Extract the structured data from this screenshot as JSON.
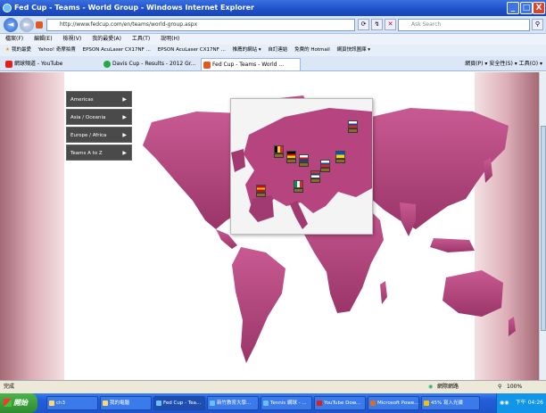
{
  "window": {
    "title": "Fed Cup - Teams - World Group - Windows Internet Explorer",
    "minimize": "_",
    "maximize": "□",
    "close": "X"
  },
  "address": {
    "back": "◄",
    "forward": "►",
    "url": "http://www.fedcup.com/en/teams/world-group.aspx",
    "search_placeholder": "Ask Search"
  },
  "menu": [
    "檔案(F)",
    "編輯(E)",
    "檢視(V)",
    "我的最愛(A)",
    "工具(T)",
    "說明(H)"
  ],
  "favorites": {
    "label": "我的最愛",
    "items": [
      "Yahoo! 奇摩拍賣",
      "EPSON AcuLaser CX17NF ...",
      "EPSON AcuLaser CX17NF ...",
      "推薦的網站 ▾",
      "自訂連結",
      "免費的 Hotmail",
      "網頁快訊圖庫 ▾"
    ]
  },
  "tabs": [
    {
      "label": "網球頻道 - YouTube",
      "color": "#e02020"
    },
    {
      "label": "Davis Cup - Results - 2012 Gr...",
      "color": "#2aa64a"
    },
    {
      "label": "Fed Cup - Teams - World ...",
      "color": "#e05a20"
    }
  ],
  "commands": "網頁(P) ▾ 安全性(S) ▾ 工具(O) ▾",
  "sidebar_menu": [
    {
      "label": "Americas"
    },
    {
      "label": "Asia / Oceania"
    },
    {
      "label": "Europe / Africa"
    },
    {
      "label": "Teams A to Z"
    }
  ],
  "menu_arrow": "▶",
  "flags": [
    {
      "name": "russia",
      "colors": [
        "#ffffff",
        "#1c3fa8",
        "#d52b1e"
      ]
    },
    {
      "name": "belgium",
      "colors": [
        "#000000",
        "#f7d117",
        "#e2253a"
      ]
    },
    {
      "name": "germany",
      "colors": [
        "#000000",
        "#dd0000",
        "#ffce00"
      ]
    },
    {
      "name": "czech-republic",
      "colors": [
        "#ffffff",
        "#d7141a",
        "#11457e"
      ]
    },
    {
      "name": "ukraine",
      "colors": [
        "#0057b8",
        "#ffd700"
      ]
    },
    {
      "name": "serbia",
      "colors": [
        "#c6363c",
        "#0c4076",
        "#ffffff"
      ]
    },
    {
      "name": "spain",
      "colors": [
        "#c60b1e",
        "#ffc400",
        "#c60b1e"
      ]
    },
    {
      "name": "italy",
      "colors": [
        "#009246",
        "#ffffff",
        "#ce2b37"
      ]
    },
    {
      "name": "slovakia",
      "colors": [
        "#ffffff",
        "#0b4ea2",
        "#ee1c25"
      ]
    }
  ],
  "status": {
    "text": "完成",
    "zone": "網際網路",
    "zoom": "100%"
  },
  "taskbar": {
    "start": "開始",
    "items": [
      "ch3",
      "我的電腦",
      "Fed Cup - Tea...",
      "新竹教育大學...",
      "Tennis 網球 - ...",
      "YouTube Dow...",
      "Microsoft Powe...",
      "45% 寫入光碟"
    ],
    "clock": "下午 04:26"
  },
  "colors": {
    "map": "#b5447f",
    "map_dark": "#8e2f62"
  }
}
